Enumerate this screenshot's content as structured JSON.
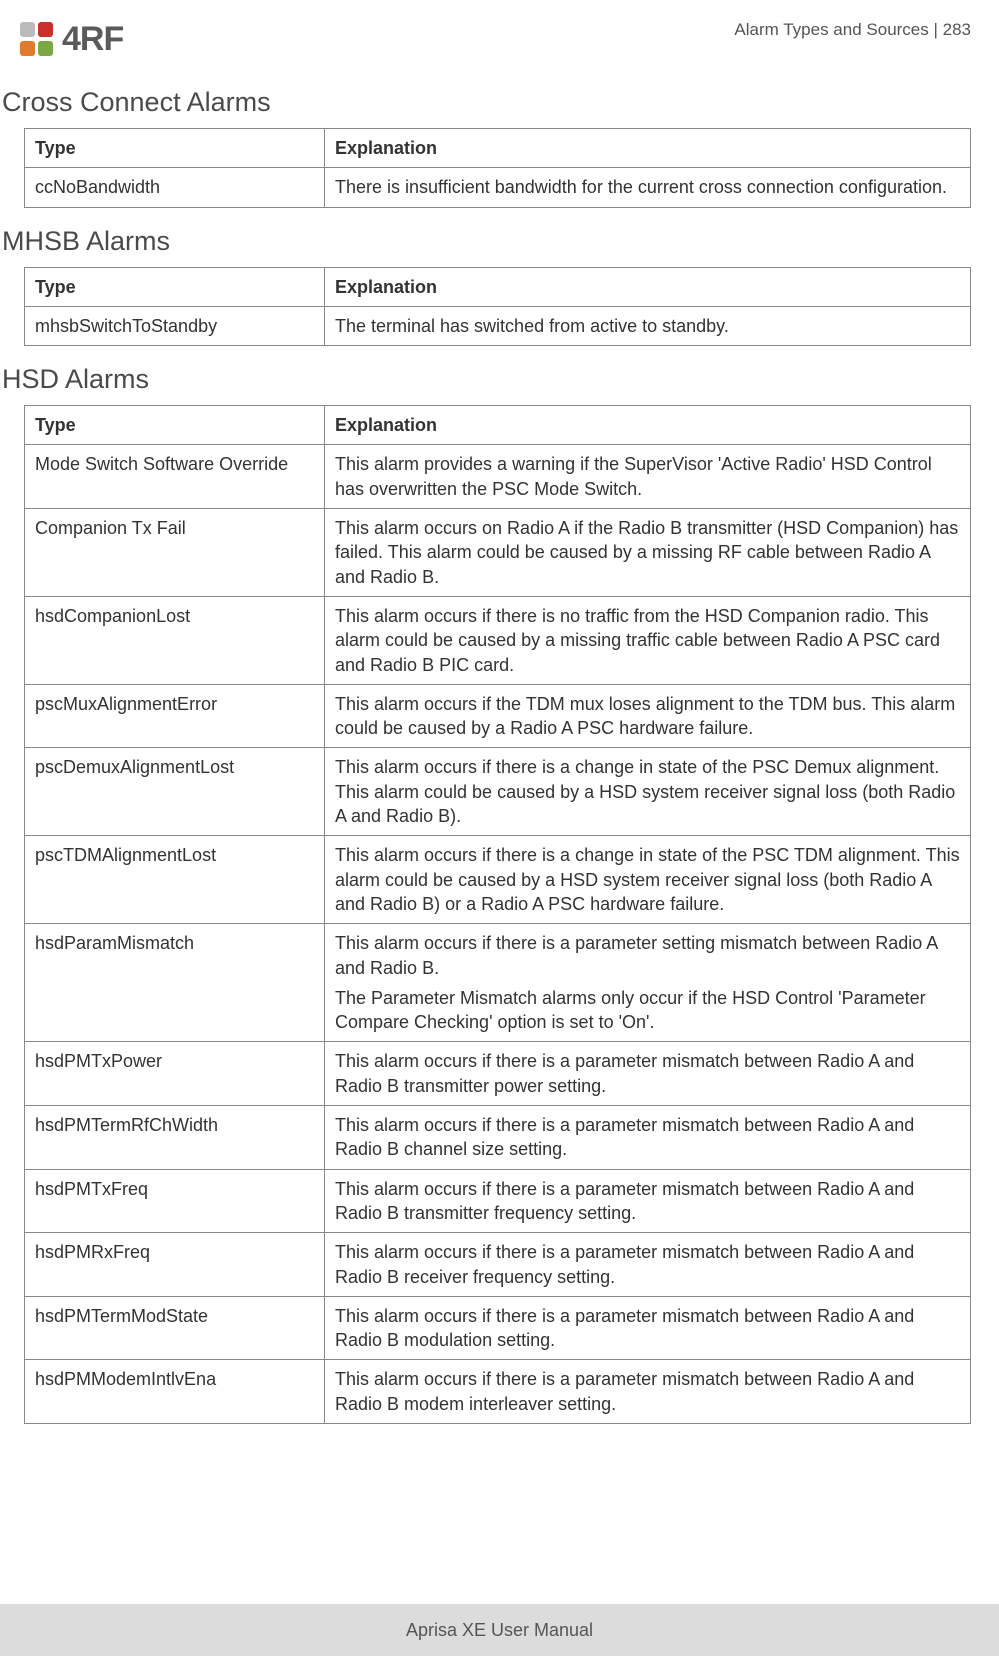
{
  "header": {
    "logo_text": "4RF",
    "right_text": "Alarm Types and Sources  |  283"
  },
  "sections": [
    {
      "title": "Cross Connect Alarms",
      "columns": [
        "Type",
        "Explanation"
      ],
      "rows": [
        {
          "type": "ccNoBandwidth",
          "explanation": [
            "There is insufficient bandwidth for the current cross connection configuration."
          ]
        }
      ]
    },
    {
      "title": "MHSB Alarms",
      "columns": [
        "Type",
        "Explanation"
      ],
      "rows": [
        {
          "type": "mhsbSwitchToStandby",
          "explanation": [
            "The terminal has switched from active to standby."
          ]
        }
      ]
    },
    {
      "title": "HSD Alarms",
      "columns": [
        "Type",
        "Explanation"
      ],
      "rows": [
        {
          "type": "Mode Switch Software Override",
          "explanation": [
            "This alarm provides a warning if the SuperVisor 'Active Radio' HSD Control has overwritten the PSC Mode Switch."
          ]
        },
        {
          "type": "Companion Tx Fail",
          "explanation": [
            "This alarm occurs on Radio A if the Radio B transmitter (HSD Companion) has failed. This alarm could be caused by a missing RF cable between Radio A and Radio B."
          ]
        },
        {
          "type": "hsdCompanionLost",
          "explanation": [
            "This alarm occurs if there is no traffic from the HSD Companion radio. This alarm could be caused by a missing traffic cable between Radio A PSC card and Radio B PIC card."
          ]
        },
        {
          "type": "pscMuxAlignmentError",
          "explanation": [
            "This alarm occurs if the TDM mux loses alignment to the TDM bus. This alarm could be caused by a Radio A PSC hardware failure."
          ]
        },
        {
          "type": "pscDemuxAlignmentLost",
          "explanation": [
            "This alarm occurs if there is a change in state of the PSC Demux alignment. This alarm could be caused by a HSD system receiver signal loss (both Radio A and Radio B)."
          ]
        },
        {
          "type": "pscTDMAlignmentLost",
          "explanation": [
            "This alarm occurs if there is a change in state of the PSC TDM alignment. This alarm could be caused by a HSD system receiver signal loss (both Radio A and Radio B) or a Radio A PSC hardware failure."
          ]
        },
        {
          "type": "hsdParamMismatch",
          "explanation": [
            "This alarm occurs if there is a parameter setting mismatch between Radio A and Radio B.",
            "The Parameter Mismatch alarms only occur if the HSD Control 'Parameter Compare Checking' option is set to 'On'."
          ]
        },
        {
          "type": "hsdPMTxPower",
          "explanation": [
            "This alarm occurs if there is a parameter mismatch between Radio A and Radio B transmitter power setting."
          ]
        },
        {
          "type": "hsdPMTermRfChWidth",
          "explanation": [
            "This alarm occurs if there is a parameter mismatch between Radio A and Radio B channel size setting."
          ]
        },
        {
          "type": "hsdPMTxFreq",
          "explanation": [
            "This alarm occurs if there is a parameter mismatch between Radio A and Radio B transmitter frequency setting."
          ]
        },
        {
          "type": "hsdPMRxFreq",
          "explanation": [
            "This alarm occurs if there is a parameter mismatch between Radio A and Radio B receiver frequency setting."
          ]
        },
        {
          "type": "hsdPMTermModState",
          "explanation": [
            "This alarm occurs if there is a parameter mismatch between Radio A and Radio B modulation setting."
          ]
        },
        {
          "type": "hsdPMModemIntlvEna",
          "explanation": [
            "This alarm occurs if there is a parameter mismatch between Radio A and Radio B modem interleaver setting."
          ]
        }
      ]
    }
  ],
  "footer": {
    "text": "Aprisa XE User Manual"
  }
}
